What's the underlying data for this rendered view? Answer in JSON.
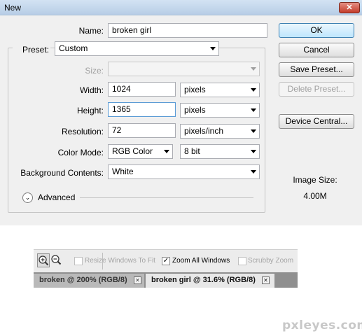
{
  "dialog": {
    "title": "New",
    "close_label": "✕",
    "name_label": "Name:",
    "name_value": "broken girl",
    "preset_label": "Preset:",
    "preset_value": "Custom",
    "size_label": "Size:",
    "size_value": "",
    "width_label": "Width:",
    "width_value": "1024",
    "width_unit": "pixels",
    "height_label": "Height:",
    "height_value": "1365",
    "height_unit": "pixels",
    "resolution_label": "Resolution:",
    "resolution_value": "72",
    "resolution_unit": "pixels/inch",
    "color_mode_label": "Color Mode:",
    "color_mode_value": "RGB Color",
    "bit_depth_value": "8 bit",
    "background_label": "Background Contents:",
    "background_value": "White",
    "advanced_label": "Advanced",
    "buttons": {
      "ok": "OK",
      "cancel": "Cancel",
      "save_preset": "Save Preset...",
      "delete_preset": "Delete Preset...",
      "device_central": "Device Central..."
    },
    "image_size_label": "Image Size:",
    "image_size_value": "4.00M"
  },
  "toolbar": {
    "resize_windows_label": "Resize Windows To Fit",
    "zoom_all_label": "Zoom All Windows",
    "scrubby_zoom_label": "Scrubby Zoom",
    "zoom_all_checked": true
  },
  "tabs": [
    {
      "label": "broken @ 200% (RGB/8)",
      "close": "✕"
    },
    {
      "label": "broken girl @ 31.6% (RGB/8)",
      "close": "✕"
    }
  ],
  "watermark": "pxleyes.com"
}
